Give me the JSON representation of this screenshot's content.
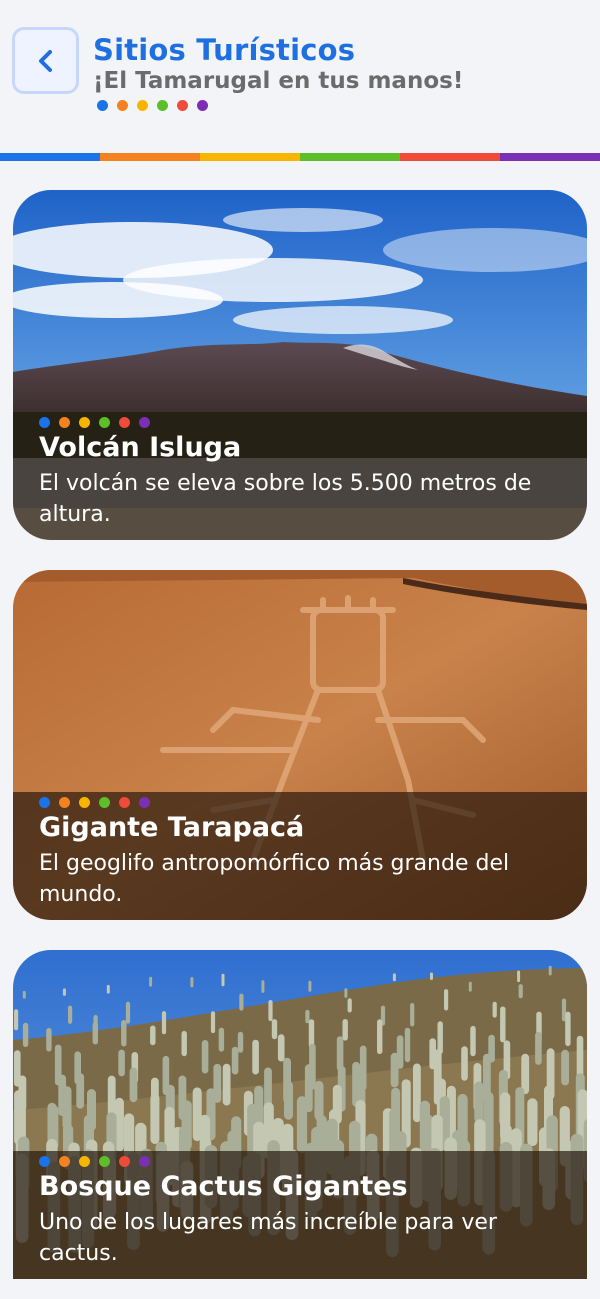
{
  "header": {
    "title": "Sitios Turísticos",
    "subtitle": "¡El Tamarugal en tus manos!",
    "back_icon": "chevron-left-icon"
  },
  "palette": [
    "#1a73e8",
    "#f58220",
    "#f7b500",
    "#5cbf2a",
    "#f04a3a",
    "#7b2fb5"
  ],
  "sites": [
    {
      "title": "Volcán Isluga",
      "description": "El volcán se eleva sobre los 5.500 metros de altura."
    },
    {
      "title": "Gigante Tarapacá",
      "description": "El geoglifo antropomórfico más grande del mundo."
    },
    {
      "title": "Bosque Cactus Gigantes",
      "description": "Uno de los lugares más increíble para ver cactus."
    }
  ]
}
